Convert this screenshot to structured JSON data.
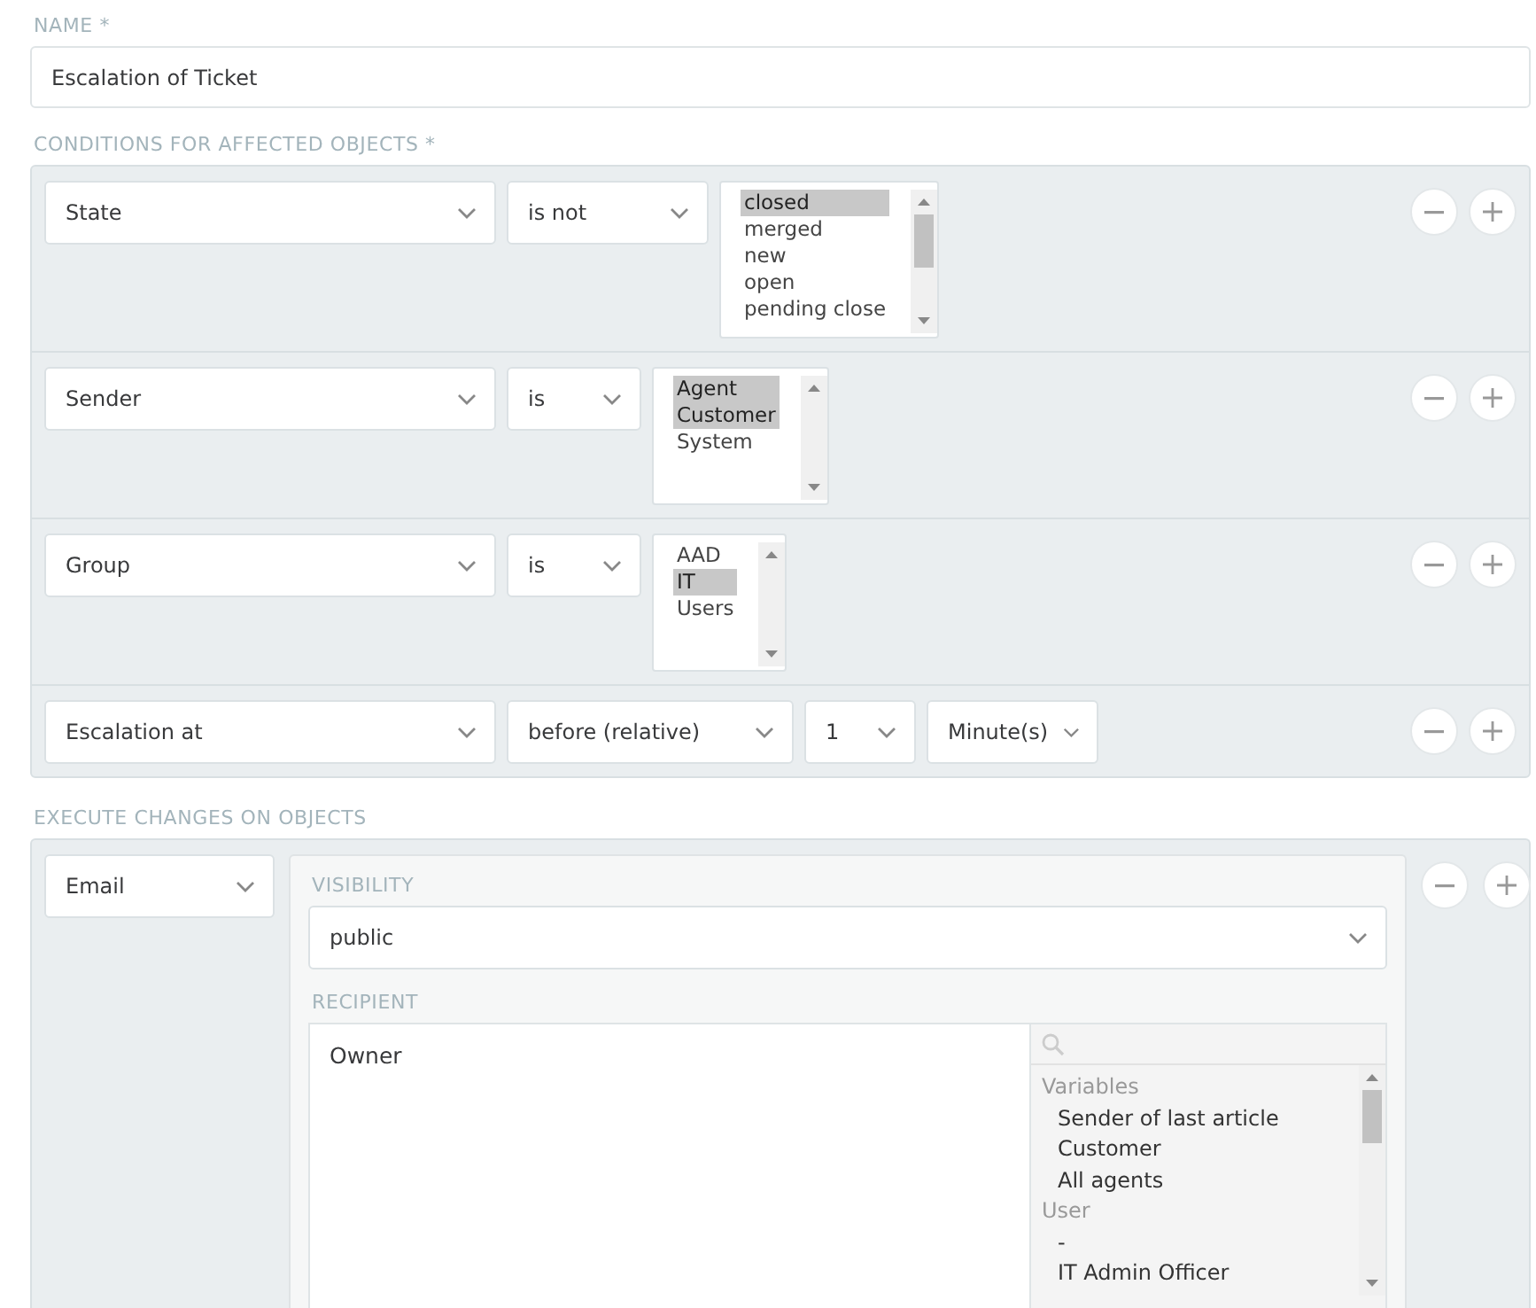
{
  "name_field": {
    "label": "NAME *",
    "value": "Escalation of Ticket"
  },
  "conditions": {
    "label": "CONDITIONS FOR AFFECTED OBJECTS *",
    "rows": [
      {
        "kind": "multiselect",
        "attribute": "State",
        "operator": "is not",
        "options": [
          {
            "label": "closed",
            "selected": true
          },
          {
            "label": "merged",
            "selected": false
          },
          {
            "label": "new",
            "selected": false
          },
          {
            "label": "open",
            "selected": false
          },
          {
            "label": "pending close",
            "selected": false
          }
        ]
      },
      {
        "kind": "multiselect",
        "attribute": "Sender",
        "operator": "is",
        "options": [
          {
            "label": "Agent",
            "selected": true
          },
          {
            "label": "Customer",
            "selected": true
          },
          {
            "label": "System",
            "selected": false
          }
        ]
      },
      {
        "kind": "multiselect",
        "attribute": "Group",
        "operator": "is",
        "options": [
          {
            "label": "AAD",
            "selected": false
          },
          {
            "label": "IT",
            "selected": true
          },
          {
            "label": "Users",
            "selected": false
          }
        ]
      },
      {
        "kind": "relative",
        "attribute": "Escalation at",
        "operator": "before (relative)",
        "amount": "1",
        "unit": "Minute(s)"
      }
    ]
  },
  "execute": {
    "label": "EXECUTE CHANGES ON OBJECTS",
    "action": "Email",
    "visibility": {
      "label": "VISIBILITY",
      "value": "public"
    },
    "recipient": {
      "label": "RECIPIENT",
      "value": "Owner",
      "groups": [
        {
          "title": "Variables",
          "items": [
            "Sender of last article",
            "Customer",
            "All agents"
          ]
        },
        {
          "title": "User",
          "items": [
            "-",
            "IT Admin Officer"
          ]
        }
      ]
    }
  }
}
